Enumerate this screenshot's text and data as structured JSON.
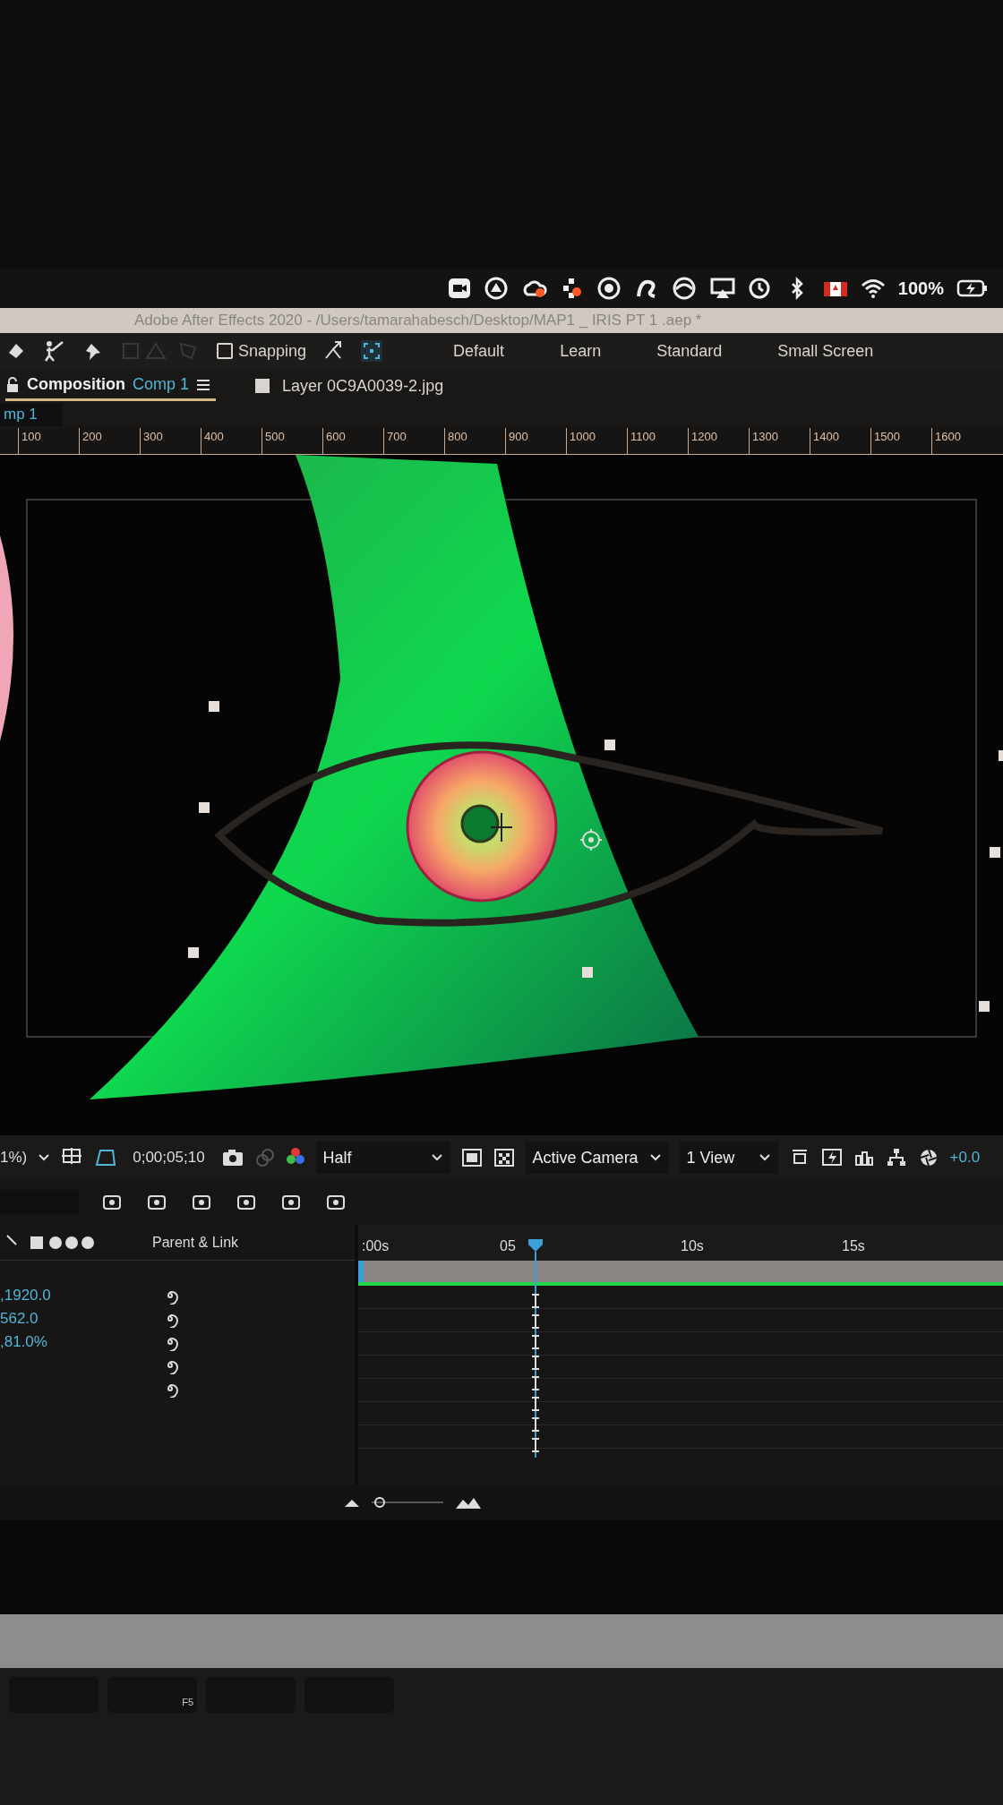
{
  "title_bar": {
    "title": "Adobe After Effects 2020 - /Users/tamarahabesch/Desktop/MAP1 _ IRIS PT 1 .aep *"
  },
  "menu_bar": {
    "battery": "100%"
  },
  "toolbar": {
    "snapping": {
      "label": "Snapping",
      "checked": false
    },
    "workspaces": [
      "Default",
      "Learn",
      "Standard",
      "Small Screen"
    ]
  },
  "panels": {
    "composition_tab": {
      "label": "Composition",
      "comp": "Comp 1"
    },
    "layer_tab": "Layer 0C9A0039-2.jpg",
    "comp_subtab": "mp 1"
  },
  "ruler": {
    "labels": [
      "100",
      "200",
      "300",
      "400",
      "500",
      "600",
      "700",
      "800",
      "900",
      "1000",
      "1100",
      "1200",
      "1300",
      "1400",
      "1500",
      "1600"
    ]
  },
  "viewer_toolbar": {
    "zoom": "1%)",
    "timecode": "0;00;05;10",
    "resolution": "Half",
    "view": "Active Camera",
    "layout": "1 View",
    "exposure": "+0.0"
  },
  "timeline": {
    "column": "Parent & Link",
    "time_labels": [
      ":00s",
      "05",
      "10s",
      "15s"
    ],
    "values": [
      ",1920.0",
      "562.0",
      ",81.0%"
    ]
  },
  "zoom_slider": {
    "level": 0.05
  },
  "keyboard": {
    "keys": [
      "F5"
    ]
  }
}
